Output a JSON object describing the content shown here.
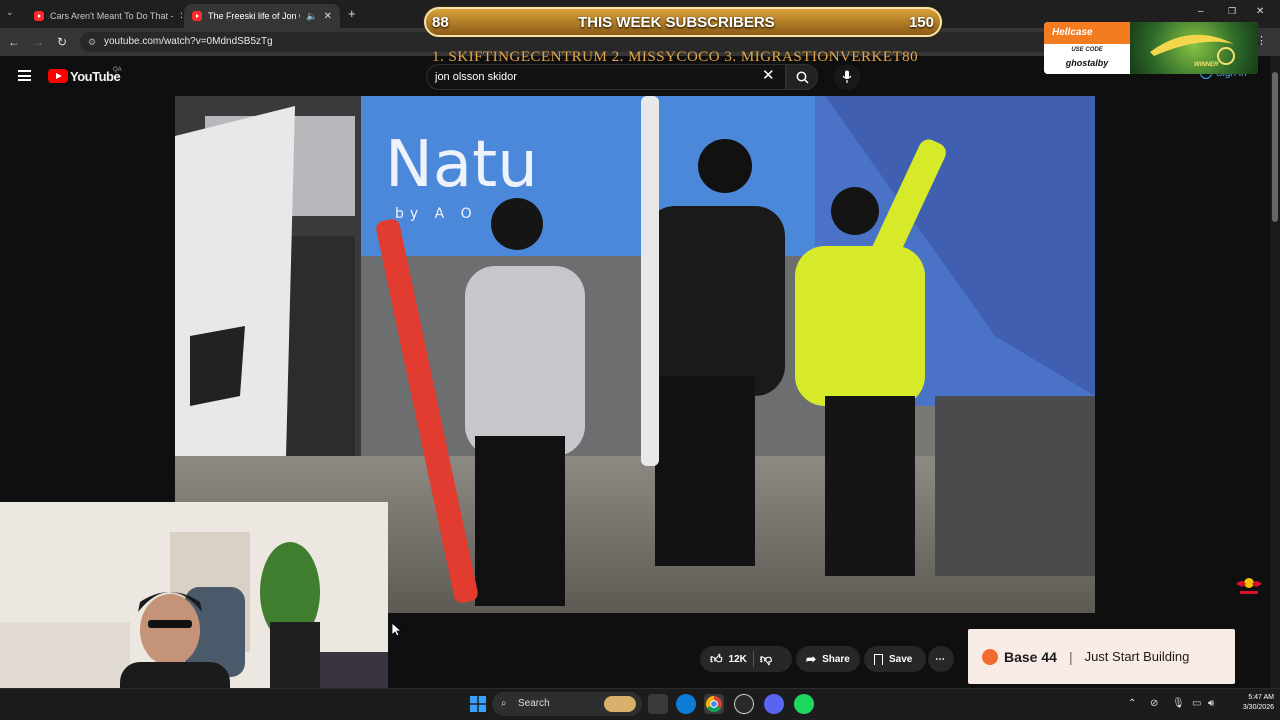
{
  "browser": {
    "tabs": [
      {
        "title": "Cars Aren't Meant To Do That -",
        "active": false
      },
      {
        "title": "The Freeski life of Jon Olsso",
        "active": true
      }
    ],
    "new_tab_icon": "plus-icon",
    "url": "youtube.com/watch?v=0MdndSB5zTg"
  },
  "youtube": {
    "logo_text": "YouTube",
    "region_code": "QA",
    "search_query": "jon olsson skidor",
    "sign_in_label": "Sign in"
  },
  "overlay": {
    "subs_left": "88",
    "subs_title": "THIS WEEK SUBSCRIBERS",
    "subs_right": "150",
    "top_subs_text": "1. SKIFTINGECENTRUM  2. MISSYCOCO  3. MIGRASTIONVERKET80",
    "hellcase": {
      "brand": "Hellcase",
      "use_code_label": "USE CODE",
      "code": "ghostalby",
      "badge": "WINNER"
    }
  },
  "video": {
    "banner_text": "Natu",
    "banner_sub": "by  A O"
  },
  "actions": {
    "likes": "12K",
    "share_label": "Share",
    "save_label": "Save"
  },
  "ad": {
    "brand": "Base 44",
    "separator": "|",
    "tagline": "Just Start Building"
  },
  "taskbar": {
    "search_label": "Search",
    "time": "5:47 AM",
    "date": "3/30/2026"
  },
  "colors": {
    "youtube_red": "#ff0000",
    "link_blue": "#3ea6ff",
    "sub_bar_gold": "#d9a23a",
    "hellcase_orange": "#f47c20",
    "base44_orange": "#f26a2e"
  }
}
